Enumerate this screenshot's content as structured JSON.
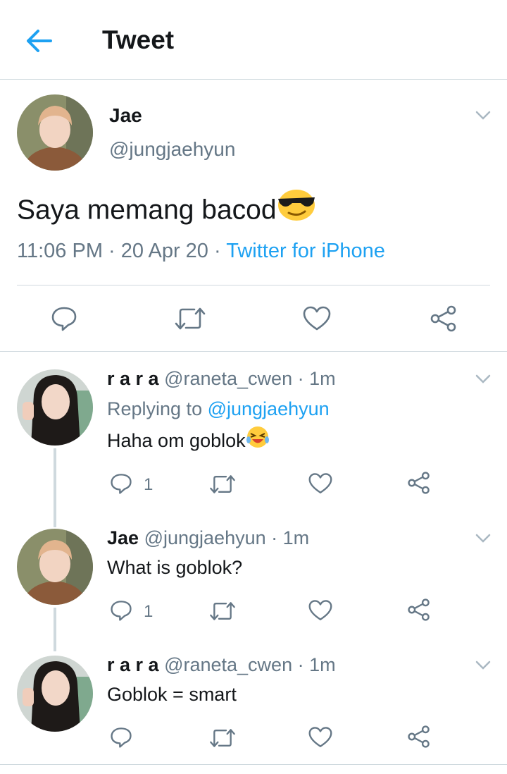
{
  "header": {
    "title": "Tweet"
  },
  "main_tweet": {
    "name": "Jae",
    "handle": "@jungjaehyun",
    "text": "Saya memang bacod",
    "emoji": "sunglasses-emoji",
    "time": "11:06 PM",
    "date": "20 Apr 20",
    "source": "Twitter for iPhone",
    "separator": "·"
  },
  "replies": [
    {
      "name": "r a r a",
      "handle": "@raneta_cwen",
      "age": "· 1m",
      "replying_label": "Replying to ",
      "replying_to": "@jungjaehyun",
      "text": "Haha om goblok",
      "emoji": "laughing-crying-emoji",
      "reply_count": "1"
    },
    {
      "name": "Jae",
      "handle": "@jungjaehyun",
      "age": "· 1m",
      "text": "What is goblok?",
      "reply_count": "1"
    },
    {
      "name": "r a r a",
      "handle": "@raneta_cwen",
      "age": "· 1m",
      "text": "Goblok = smart"
    }
  ],
  "colors": {
    "accent": "#1da1f2",
    "text": "#14171a",
    "muted": "#657786",
    "divider": "#cfd9de"
  }
}
